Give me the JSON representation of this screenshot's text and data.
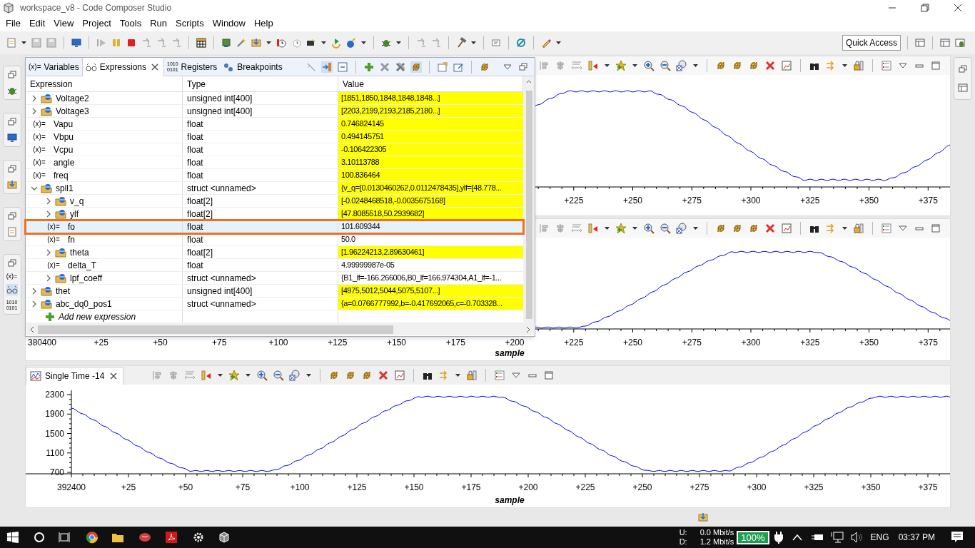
{
  "window": {
    "title": "workspace_v8 - Code Composer Studio"
  },
  "menu": [
    "File",
    "Edit",
    "View",
    "Project",
    "Tools",
    "Run",
    "Scripts",
    "Window",
    "Help"
  ],
  "quick_access": {
    "label": "Quick Access"
  },
  "left_strip_labels": [
    [
      "(x)="
    ],
    [
      "1010",
      "0101"
    ]
  ],
  "expressions_view": {
    "tabs": [
      {
        "label": "Variables",
        "icon": "(x)=",
        "selected": false
      },
      {
        "label": "Expressions",
        "selected": true
      },
      {
        "label": "Registers",
        "icon_lines": [
          "1010",
          "0101"
        ],
        "selected": false
      },
      {
        "label": "Breakpoints",
        "selected": false
      }
    ],
    "columns": [
      "Expression",
      "Type",
      "Value"
    ],
    "rows": [
      {
        "name": "Voltage2",
        "type": "unsigned int[400]",
        "value": "[1851,1850,1848,1848,1848...]",
        "kind": "aggregate",
        "expanded": false,
        "changed": true,
        "selected": false
      },
      {
        "name": "Voltage3",
        "type": "unsigned int[400]",
        "value": "[2203,2199,2193,2185,2180...]",
        "kind": "aggregate",
        "expanded": false,
        "changed": true,
        "selected": false
      },
      {
        "name": "Vapu",
        "type": "float",
        "value": "0.746824145",
        "kind": "variable",
        "icon": "(x)=",
        "changed": true,
        "selected": false
      },
      {
        "name": "Vbpu",
        "type": "float",
        "value": "0.494145751",
        "kind": "variable",
        "icon": "(x)=",
        "changed": true,
        "selected": false
      },
      {
        "name": "Vcpu",
        "type": "float",
        "value": "-0.106422305",
        "kind": "variable",
        "icon": "(x)=",
        "changed": true,
        "selected": false
      },
      {
        "name": "angle",
        "type": "float",
        "value": "3.10113788",
        "kind": "variable",
        "icon": "(x)=",
        "changed": true,
        "selected": false
      },
      {
        "name": "freq",
        "type": "float",
        "value": "100.836464",
        "kind": "variable",
        "icon": "(x)=",
        "changed": true,
        "selected": false
      },
      {
        "name": "spll1",
        "type": "struct <unnamed>",
        "value": "{v_q=[0.0130460262,0.0112478435],ylf=[48.778...",
        "kind": "aggregate",
        "expanded": true,
        "changed": true,
        "selected": false,
        "children": [
          {
            "name": "v_q",
            "type": "float[2]",
            "value": "[-0.0248468518,-0.0035675168]",
            "kind": "aggregate",
            "expanded": false,
            "changed": true,
            "selected": false
          },
          {
            "name": "ylf",
            "type": "float[2]",
            "value": "[47.8085518,50.2939682]",
            "kind": "aggregate",
            "expanded": false,
            "changed": true,
            "selected": false
          },
          {
            "name": "fo",
            "type": "float",
            "value": "101.609344",
            "kind": "variable",
            "icon": "(x)=",
            "changed": false,
            "selected": true
          },
          {
            "name": "fn",
            "type": "float",
            "value": "50.0",
            "kind": "variable",
            "icon": "(x)=",
            "changed": false,
            "selected": false
          },
          {
            "name": "theta",
            "type": "float[2]",
            "value": "[1.96224213,2.89630461]",
            "kind": "aggregate",
            "expanded": false,
            "changed": true,
            "selected": false
          },
          {
            "name": "delta_T",
            "type": "float",
            "value": "4.99999987e-05",
            "kind": "variable",
            "icon": "(x)=",
            "changed": false,
            "selected": false
          },
          {
            "name": "lpf_coeff",
            "type": "struct <unnamed>",
            "value": "{B1_lf=-166.266006,B0_lf=166.974304,A1_lf=-1...",
            "kind": "aggregate",
            "expanded": false,
            "changed": false,
            "selected": false
          }
        ]
      },
      {
        "name": "thet",
        "type": "unsigned int[400]",
        "value": "[4975,5012,5044,5075,5107...]",
        "kind": "aggregate",
        "expanded": false,
        "changed": true,
        "selected": false
      },
      {
        "name": "abc_dq0_pos1",
        "type": "struct <unnamed>",
        "value": "{a=0.0766777992,b=-0.417692065,c=-0.703328...",
        "kind": "aggregate",
        "expanded": false,
        "changed": true,
        "selected": false
      }
    ],
    "add_row": {
      "label": "Add new expression"
    }
  },
  "graphs": [
    {
      "x_ticks": [
        "+225",
        "+250",
        "+275",
        "+300",
        "+325",
        "+350",
        "+375"
      ]
    },
    {
      "x_ticks": [
        "380400",
        "+25",
        "+50",
        "+75",
        "+100",
        "+125",
        "+150",
        "+175",
        "+200",
        "+225",
        "+250",
        "+275",
        "+300",
        "+325",
        "+350",
        "+375"
      ],
      "xlabel": "sample"
    }
  ],
  "single_time": {
    "tab": {
      "label": "Single Time -14"
    },
    "y_ticks": [
      "2300",
      "1900",
      "1500",
      "1100",
      "700"
    ],
    "x_ticks": [
      "392400",
      "+25",
      "+50",
      "+75",
      "+100",
      "+125",
      "+150",
      "+175",
      "+200",
      "+225",
      "+250",
      "+275",
      "+300",
      "+325",
      "+350",
      "+375"
    ],
    "xlabel": "sample"
  },
  "taskbar": {
    "up_label": "U:",
    "up": "0.0 Mbit/s",
    "down_label": "D:",
    "down": "1.2 Mbit/s",
    "battery": "100%",
    "language": "ENG",
    "time": "03:37 PM"
  }
}
